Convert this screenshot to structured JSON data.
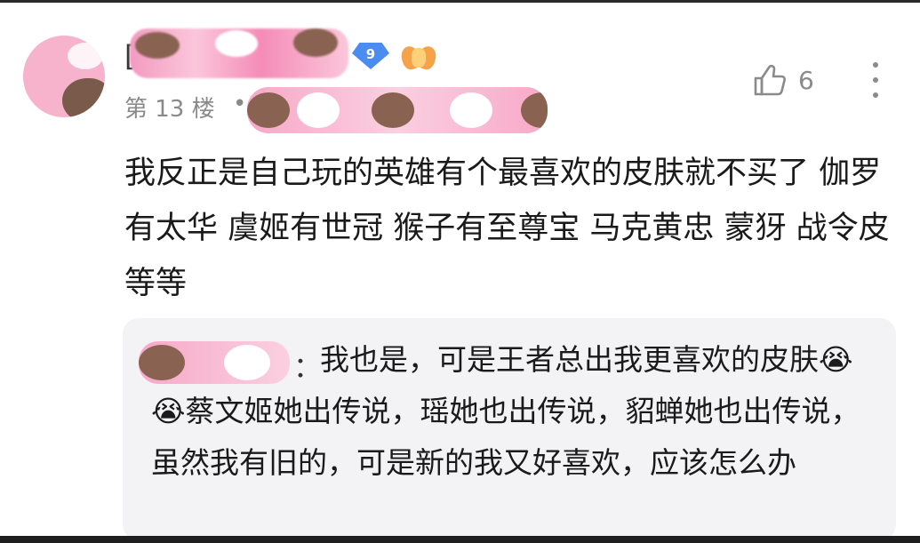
{
  "comment": {
    "floor_label": "第 13 楼",
    "floor_separator": "•",
    "level": "9",
    "name_prefix": "[",
    "likes": "6",
    "body": "我反正是自己玩的英雄有个最喜欢的皮肤就不买了 伽罗有太华 虞姬有世冠 猴子有至尊宝 马克黄忠 蒙犽 战令皮等等"
  },
  "reply": {
    "colon": "：",
    "text": "我也是，可是王者总出我更喜欢的皮肤😭😭蔡文姬她出传说，瑶她也出传说，貂蝉她也出传说，虽然我有旧的，可是新的我又好喜欢，应该怎么办"
  },
  "icons": {
    "like": "thumbs-up-icon",
    "more": "more-vertical-icon",
    "level": "diamond-level-icon",
    "medal": "medal-icon"
  },
  "colors": {
    "level_badge": "#4b8cf0",
    "meta_text": "#8a8a8a",
    "reply_bg": "#f3f3f5"
  }
}
